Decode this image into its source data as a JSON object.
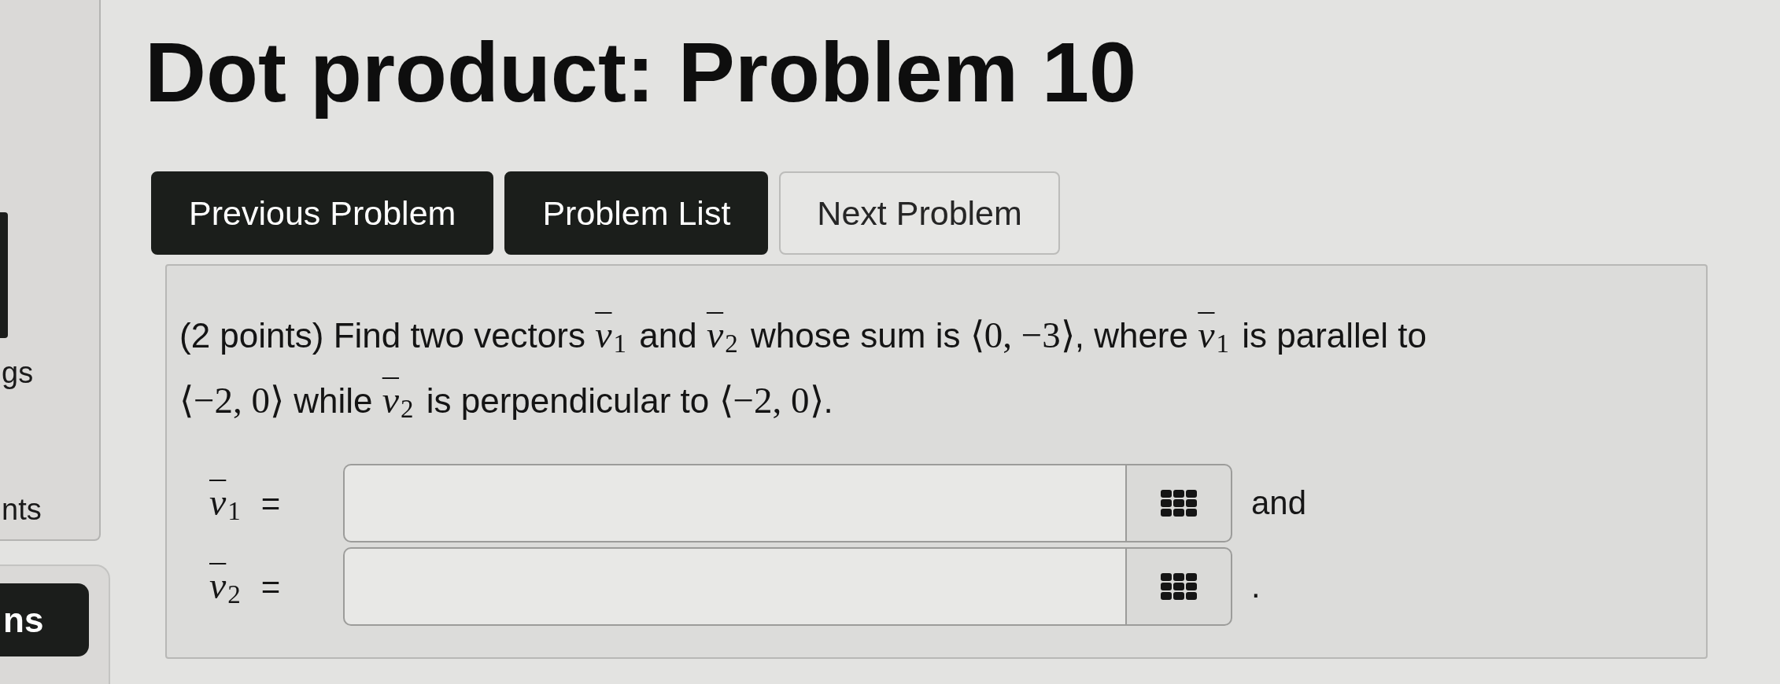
{
  "sidebar": {
    "items": [
      {
        "label": "gs"
      },
      {
        "label": "nts"
      }
    ],
    "button": "ns"
  },
  "title": "Dot product: Problem 10",
  "nav_buttons": [
    {
      "label": "Previous Problem",
      "disabled": false
    },
    {
      "label": "Problem List",
      "disabled": false
    },
    {
      "label": "Next Problem",
      "disabled": true
    }
  ],
  "problem": {
    "statement": [
      {
        "kind": "text",
        "text": "(2 points) Find two vectors "
      },
      {
        "kind": "vector",
        "symbol": "v",
        "index": "1"
      },
      {
        "kind": "text",
        "text": " and "
      },
      {
        "kind": "vector",
        "symbol": "v",
        "index": "2"
      },
      {
        "kind": "text",
        "text": " whose sum is "
      },
      {
        "kind": "math",
        "text": "⟨0, −3⟩"
      },
      {
        "kind": "text",
        "text": ", where "
      },
      {
        "kind": "vector",
        "symbol": "v",
        "index": "1"
      },
      {
        "kind": "text",
        "text": " is parallel to "
      },
      {
        "kind": "math",
        "text": "⟨−2, 0⟩"
      },
      {
        "kind": "text",
        "text": " while "
      },
      {
        "kind": "vector",
        "symbol": "v",
        "index": "2"
      },
      {
        "kind": "text",
        "text": " is perpendicular to "
      },
      {
        "kind": "math",
        "text": "⟨−2, 0⟩"
      },
      {
        "kind": "text",
        "text": "."
      }
    ],
    "answers": [
      {
        "vector": {
          "symbol": "v",
          "index": "1"
        },
        "relation": "=",
        "after": "and"
      },
      {
        "vector": {
          "symbol": "v",
          "index": "2"
        },
        "relation": "=",
        "after": "."
      }
    ]
  }
}
